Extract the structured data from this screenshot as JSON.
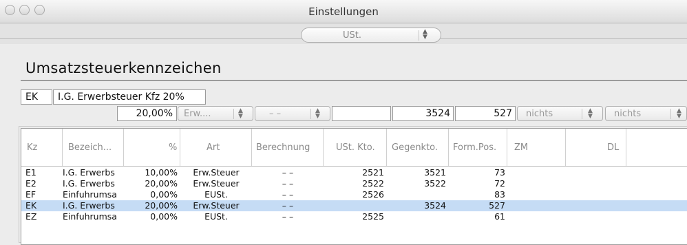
{
  "window": {
    "title": "Einstellungen"
  },
  "toolbar": {
    "selector_value": "USt."
  },
  "section": {
    "heading": "Umsatzsteuerkennzeichen"
  },
  "editor": {
    "kz": "EK",
    "bezeichnung": "I.G. Erwerbsteuer Kfz 20%",
    "prozent": "20,00%",
    "art_popup": "Erw....",
    "berechnung_popup": "– –",
    "empty_field": "",
    "ust_konto": "3524",
    "form_pos": "527",
    "zm_popup": "nichts",
    "dl_popup": "nichts"
  },
  "table": {
    "columns": [
      "Kz",
      "Bezeich...",
      "%",
      "Art",
      "Berechnung",
      "USt. Kto.",
      "Gegenkto.",
      "Form.Pos.",
      "ZM",
      "DL"
    ],
    "rows": [
      {
        "kz": "E1",
        "bez": "I.G. Erwerbs",
        "pct": "10,00%",
        "art": "Erw.Steuer",
        "ber": "– –",
        "ust": "2521",
        "gegen": "3521",
        "form": "73",
        "selected": false
      },
      {
        "kz": "E2",
        "bez": "I.G. Erwerbs",
        "pct": "20,00%",
        "art": "Erw.Steuer",
        "ber": "– –",
        "ust": "2522",
        "gegen": "3522",
        "form": "72",
        "selected": false
      },
      {
        "kz": "EF",
        "bez": "Einfuhrumsa",
        "pct": "0,00%",
        "art": "EUSt.",
        "ber": "– –",
        "ust": "2526",
        "gegen": "",
        "form": "83",
        "selected": false
      },
      {
        "kz": "EK",
        "bez": "I.G. Erwerbs",
        "pct": "20,00%",
        "art": "Erw.Steuer",
        "ber": "– –",
        "ust": "",
        "gegen": "3524",
        "form": "527",
        "selected": true
      },
      {
        "kz": "EZ",
        "bez": "Einfuhrumsa",
        "pct": "0,00%",
        "art": "EUSt.",
        "ber": "– –",
        "ust": "2525",
        "gegen": "",
        "form": "61",
        "selected": false
      }
    ]
  },
  "colors": {
    "selection": "#c5dcf5",
    "titlebar": "#dcdcdc"
  }
}
